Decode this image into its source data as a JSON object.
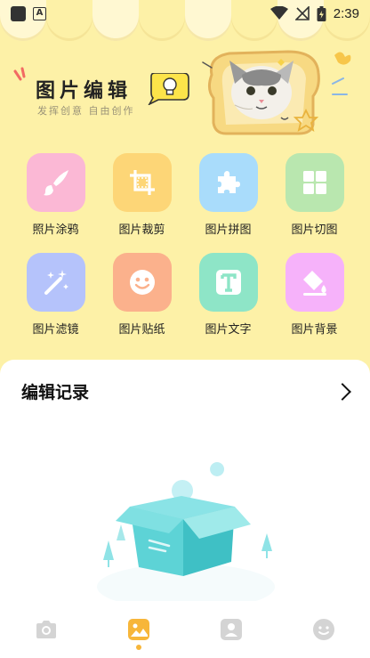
{
  "status_bar": {
    "time": "2:39",
    "notification_letter": "A"
  },
  "hero": {
    "title": "图片编辑",
    "subtitle": "发挥创意 自由创作"
  },
  "tools": [
    {
      "label": "照片涂鸦",
      "icon": "brush-icon",
      "color": "#fbb8d5"
    },
    {
      "label": "图片裁剪",
      "icon": "crop-icon",
      "color": "#fdd677"
    },
    {
      "label": "图片拼图",
      "icon": "puzzle-icon",
      "color": "#a9dcfb"
    },
    {
      "label": "图片切图",
      "icon": "grid-icon",
      "color": "#b9e7af"
    },
    {
      "label": "图片滤镜",
      "icon": "magic-wand-icon",
      "color": "#b5c3fb"
    },
    {
      "label": "图片贴纸",
      "icon": "smiley-icon",
      "color": "#fbb18c"
    },
    {
      "label": "图片文字",
      "icon": "text-icon",
      "color": "#8ee5c7"
    },
    {
      "label": "图片背景",
      "icon": "paint-bucket-icon",
      "color": "#f6b2fa"
    }
  ],
  "records": {
    "title": "编辑记录"
  },
  "nav": [
    {
      "name": "camera",
      "icon": "camera-icon",
      "active": false
    },
    {
      "name": "gallery",
      "icon": "picture-icon",
      "active": true
    },
    {
      "name": "profile",
      "icon": "person-icon",
      "active": false
    },
    {
      "name": "mine",
      "icon": "smiley-icon",
      "active": false
    }
  ],
  "colors": {
    "background": "#fdf1a7",
    "accent": "#f7b63a",
    "panel": "#ffffff"
  }
}
